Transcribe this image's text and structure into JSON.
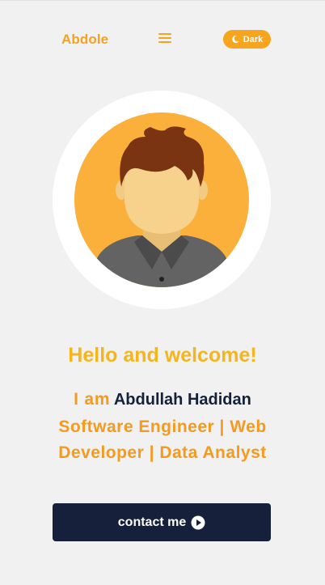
{
  "navbar": {
    "brand": "Abdole",
    "menu_icon": "hamburger-menu-icon",
    "theme_toggle": {
      "label": "Dark",
      "icon": "moon-icon"
    }
  },
  "hero": {
    "avatar": "avatar-illustration",
    "greeting": "Hello and welcome!",
    "intro_prefix": "I am",
    "name": "Abdullah Hadidan",
    "roles": "Software Engineer | Web Developer | Data Analyst",
    "contact_button": {
      "label": "contact me",
      "icon": "play-circle-icon"
    }
  },
  "colors": {
    "background": "#f1f1f1",
    "accent": "#f4a21f",
    "greeting": "#f5b51d",
    "dark": "#16203a"
  }
}
